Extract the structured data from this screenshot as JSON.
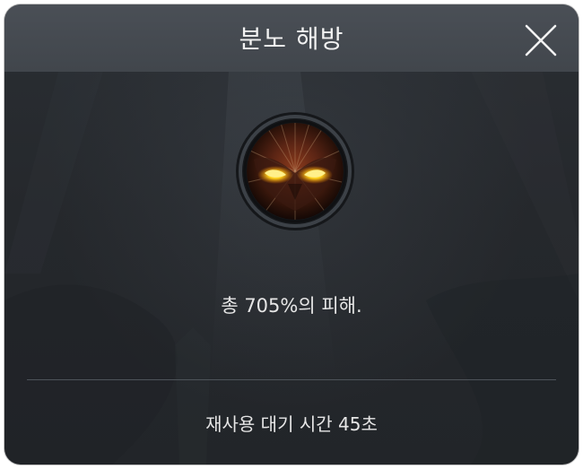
{
  "dialog": {
    "title": "분노 해방",
    "close_icon": "close-icon",
    "skill_icon": "demon-eyes-skill-icon",
    "description": "총 705%의 피해.",
    "cooldown": "재사용 대기 시간 45초"
  },
  "colors": {
    "header_bg": "#43484e",
    "body_bg": "#25282c",
    "text": "#e6e6e6",
    "divider": "#4e545a",
    "eye_glow": "#ffd21a"
  }
}
